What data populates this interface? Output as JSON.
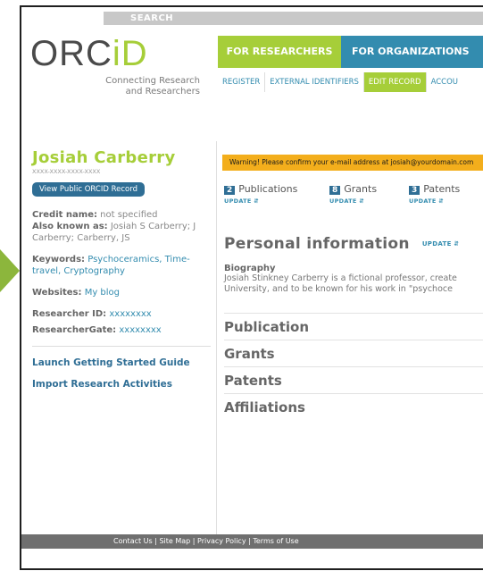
{
  "header": {
    "search_label": "SEARCH",
    "logo_main": "ORC",
    "logo_accent": "iD",
    "tagline_line1": "Connecting Research",
    "tagline_line2": "and Researchers"
  },
  "nav": {
    "primary": [
      "FOR RESEARCHERS",
      "FOR ORGANIZATIONS"
    ],
    "secondary": [
      "REGISTER",
      "EXTERNAL IDENTIFIERS",
      "EDIT RECORD",
      "ACCOU"
    ]
  },
  "profile": {
    "name": "Josiah Carberry",
    "orcid_id": "XXXX-XXXX-XXXX-XXXX",
    "view_public_label": "View Public ORCID Record",
    "credit_name_label": "Credit name:",
    "credit_name_value": "not specified",
    "aka_label": "Also known as:",
    "aka_value": "Josiah S Carberry; J Carberry; Carberry, JS",
    "keywords_label": "Keywords:",
    "keywords_value": "Psychoceramics, Time-travel, Cryptography",
    "websites_label": "Websites:",
    "websites_value": "My blog",
    "researcher_id_label": "Researcher ID:",
    "researcher_id_value": "xxxxxxxx",
    "researchergate_label": "ResearcherGate:",
    "researchergate_value": "xxxxxxxx",
    "launch_guide": "Launch Getting Started Guide",
    "import_activities": "Import Research Activities"
  },
  "warning": "Warning! Please confirm your e-mail address at josiah@yourdomain.com",
  "counts": [
    {
      "num": "2",
      "label": "Publications",
      "update": "UPDATE ⮃"
    },
    {
      "num": "8",
      "label": "Grants",
      "update": "UPDATE ⮃"
    },
    {
      "num": "3",
      "label": "Patents",
      "update": "UPDATE ⮃"
    }
  ],
  "personal": {
    "title": "Personal information",
    "update": "UPDATE ⮃",
    "bio_label": "Biography",
    "bio_line1": "Josiah Stinkney Carberry is a fictional professor, create",
    "bio_line2": "University, and to be known for his work in \"psychoce"
  },
  "sections": [
    "Publication",
    "Grants",
    "Patents",
    "Affiliations"
  ],
  "footer": "Contact Us  |  Site Map  |  Privacy Policy  |  Terms of Use",
  "colors": {
    "orcid_green": "#a6ce39",
    "orcid_blue": "#338caf",
    "warning": "#f3ae1c"
  }
}
